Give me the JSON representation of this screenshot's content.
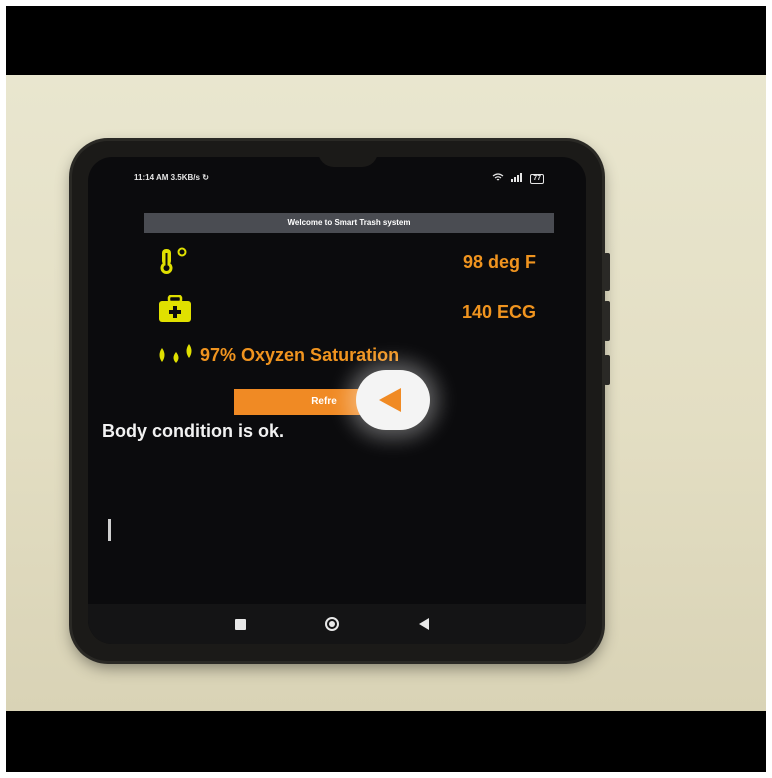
{
  "status_bar": {
    "time": "11:14 AM",
    "network_speed": "3.5KB/s",
    "battery": "77",
    "icons": [
      "wifi-icon",
      "signal-icon",
      "battery-icon"
    ]
  },
  "app": {
    "title": "Welcome to Smart Trash system"
  },
  "readings": {
    "temperature": {
      "icon": "thermometer-icon",
      "value": "98 deg F"
    },
    "ecg": {
      "icon": "medical-kit-icon",
      "value": "140 ECG"
    },
    "oxygen": {
      "icon": "droplets-icon",
      "value": "97% Oxyzen Saturation"
    }
  },
  "actions": {
    "refresh_label": "Refre"
  },
  "status_message": "Body condition is ok.",
  "video_overlay": {
    "icon": "play-back-icon"
  },
  "nav_bar": {
    "icons": [
      "recent-apps-icon",
      "home-icon",
      "back-icon"
    ]
  },
  "colors": {
    "accent_orange": "#f08a24",
    "icon_yellow": "#e0e000",
    "screen_bg": "#0b0b0d",
    "title_bar_bg": "#4a4c52"
  }
}
